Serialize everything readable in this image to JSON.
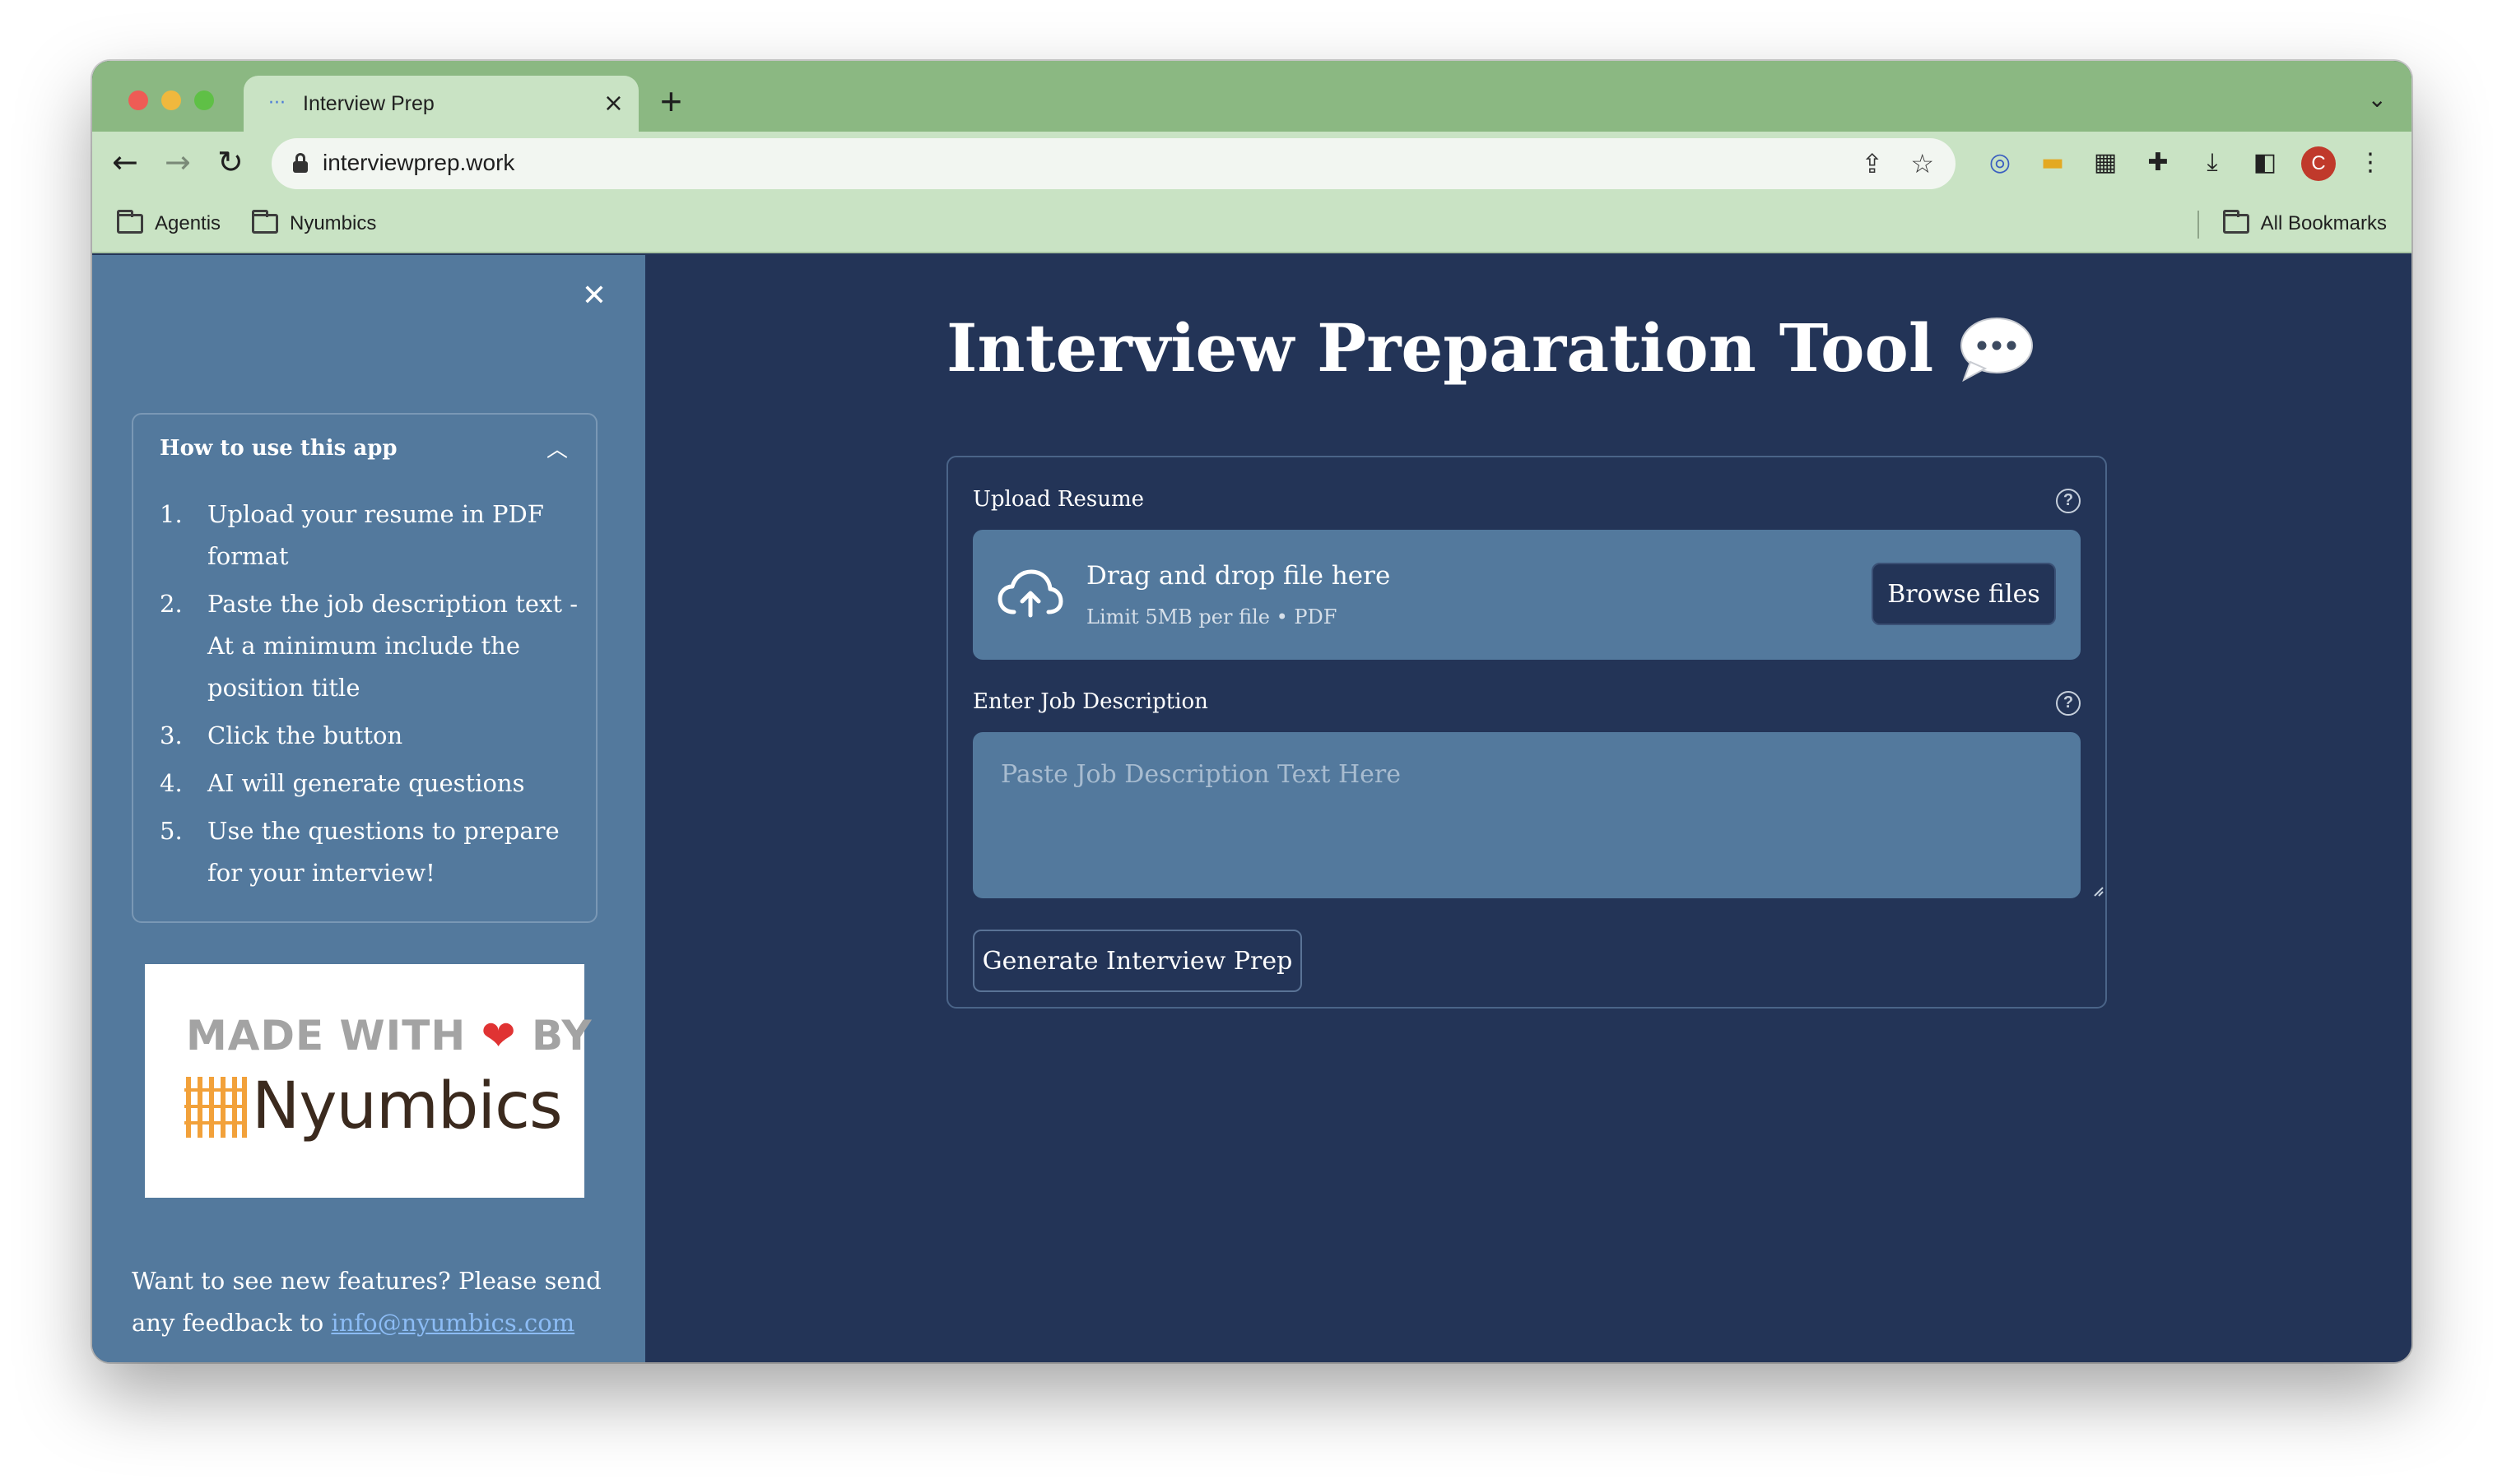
{
  "browser": {
    "tab_title": "Interview Prep",
    "tab_close": "×",
    "new_tab": "+",
    "url": "interviewprep.work",
    "profile_initial": "C",
    "bookmarks": [
      "Agentis",
      "Nyumbics"
    ],
    "all_bookmarks": "All Bookmarks"
  },
  "sidebar": {
    "close": "✕",
    "expander_title": "How to use this app",
    "steps": [
      {
        "num": "1.",
        "text": "Upload your resume in PDF format"
      },
      {
        "num": "2.",
        "text": "Paste the job description text - At a minimum include the position title"
      },
      {
        "num": "3.",
        "text": "Click the button"
      },
      {
        "num": "4.",
        "text": "AI will generate questions"
      },
      {
        "num": "5.",
        "text": "Use the questions to prepare for your interview!"
      }
    ],
    "logo": {
      "made_with": "MADE WITH",
      "by": "BY",
      "brand": "Nyumbics"
    },
    "feedback_text": "Want to see new features? Please send any feedback to ",
    "feedback_email": "info@nyumbics.com"
  },
  "main": {
    "title": "Interview Preparation Tool",
    "upload": {
      "label": "Upload Resume",
      "drag_text": "Drag and drop file here",
      "limit_text": "Limit 5MB per file • PDF",
      "browse_label": "Browse files"
    },
    "job": {
      "label": "Enter Job Description",
      "placeholder": "Paste Job Description Text Here",
      "value": ""
    },
    "generate_label": "Generate Interview Prep"
  },
  "colors": {
    "main_bg": "#233457",
    "sidebar_bg": "#53799d",
    "tab_strip": "#8bb882",
    "toolbar": "#c9e3c4"
  }
}
